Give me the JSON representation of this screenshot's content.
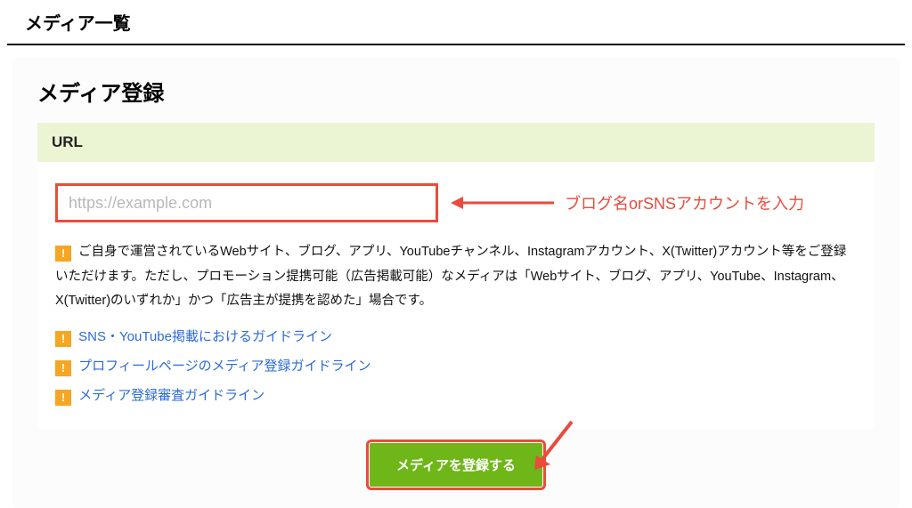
{
  "page": {
    "title": "メディア一覧"
  },
  "panel": {
    "title": "メディア登録",
    "section_label": "URL"
  },
  "form": {
    "url_placeholder": "https://example.com",
    "annotation": "ブログ名orSNSアカウントを入力",
    "description": "ご自身で運営されているWebサイト、ブログ、アプリ、YouTubeチャンネル、Instagramアカウント、X(Twitter)アカウント等をご登録いただけます。ただし、プロモーション提携可能（広告掲載可能）なメディアは「Webサイト、ブログ、アプリ、YouTube、Instagram、X(Twitter)のいずれか」かつ「広告主が提携を認めた」場合です。",
    "badge": "!",
    "links": [
      "SNS・YouTube掲載におけるガイドライン",
      "プロフィールページのメディア登録ガイドライン",
      "メディア登録審査ガイドライン"
    ],
    "submit_label": "メディアを登録する"
  },
  "colors": {
    "highlight": "#e94b3c",
    "accent_green": "#6fb619",
    "section_bg": "#ecf5d3",
    "badge": "#f5a623",
    "link": "#2b6bd6"
  }
}
